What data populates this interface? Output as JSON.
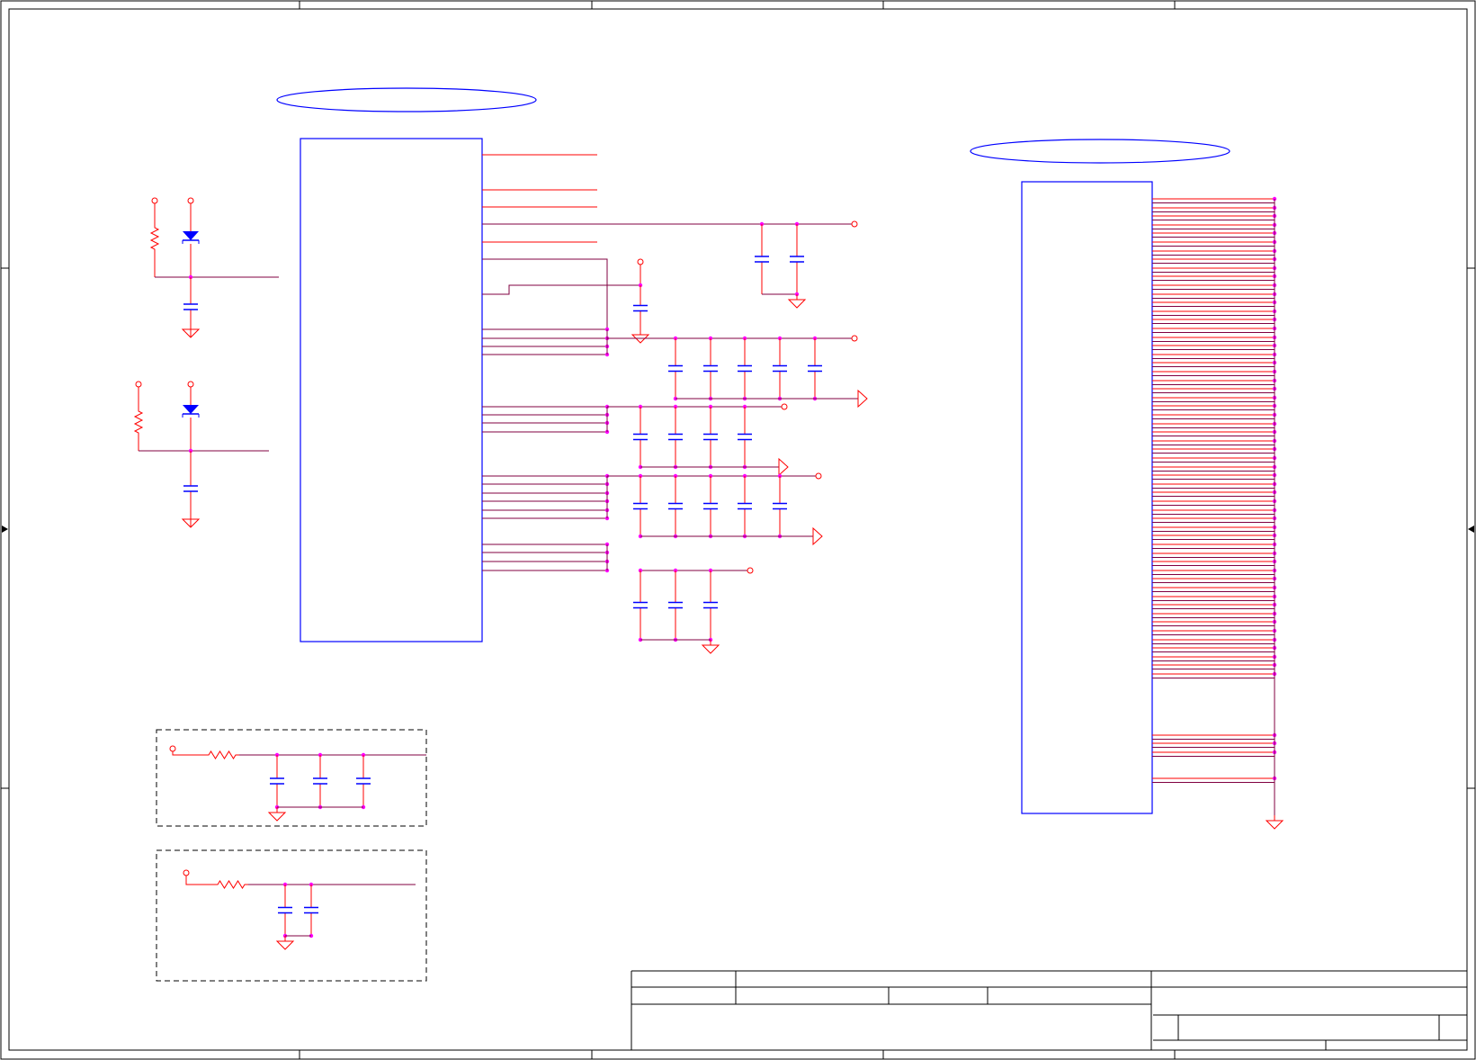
{
  "title_block": {
    "cells": []
  },
  "colors": {
    "frame": "#000000",
    "component": "#0000ff",
    "wire": "#ff0000",
    "net": "#800040",
    "junction": "#ff00ff",
    "region": "#000000"
  },
  "component_groups": [
    {
      "id": "u1",
      "kind": "ic",
      "pins_left": 0,
      "pins_right": 26
    },
    {
      "id": "u2",
      "kind": "connector",
      "pins_right": 60
    },
    {
      "id": "led-circuit-1",
      "kind": "led-resistor-capacitor"
    },
    {
      "id": "led-circuit-2",
      "kind": "led-resistor-capacitor"
    },
    {
      "id": "rc-filter-1",
      "kind": "resistor-3-capacitors"
    },
    {
      "id": "rc-filter-2",
      "kind": "resistor-2-capacitors"
    }
  ]
}
